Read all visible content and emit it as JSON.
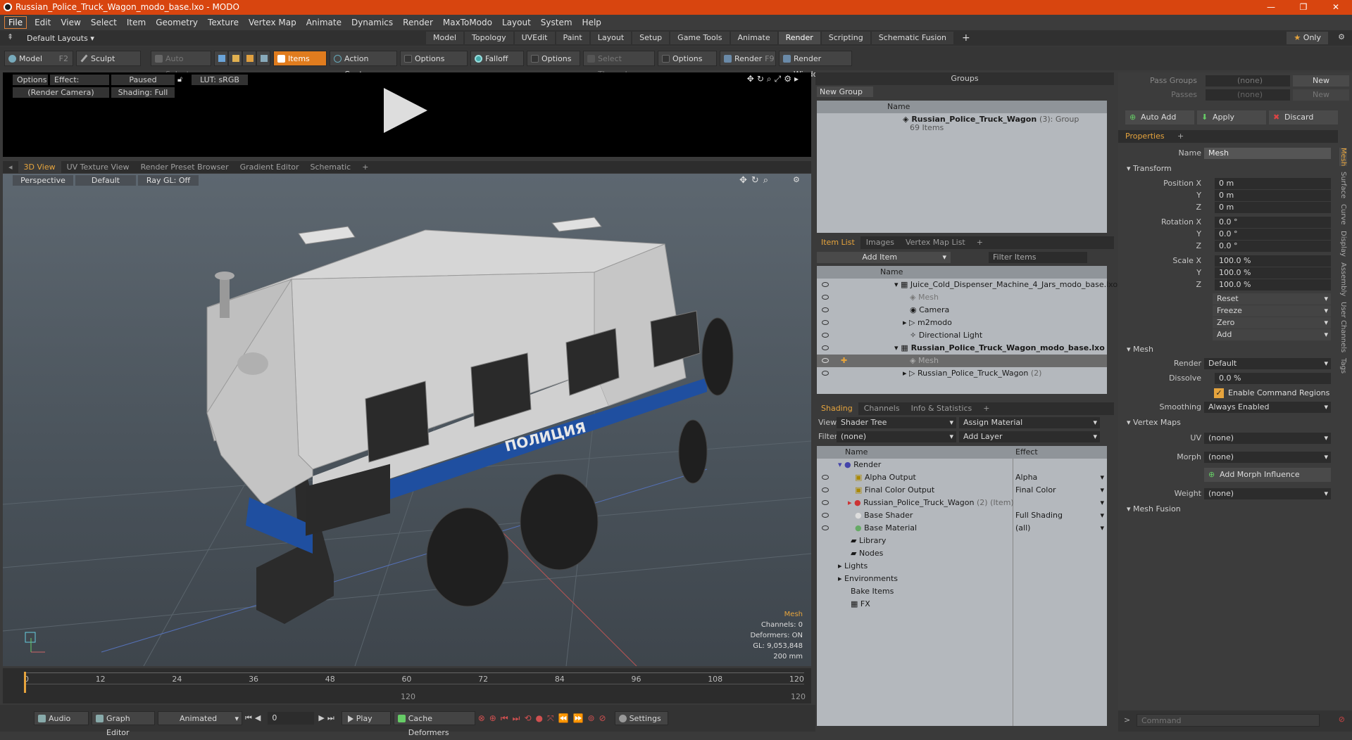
{
  "window": {
    "title": "Russian_Police_Truck_Wagon_modo_base.lxo - MODO"
  },
  "menu": [
    "File",
    "Edit",
    "View",
    "Select",
    "Item",
    "Geometry",
    "Texture",
    "Vertex Map",
    "Animate",
    "Dynamics",
    "Render",
    "MaxToModo",
    "Layout",
    "System",
    "Help"
  ],
  "layout": {
    "dropdown": "Default Layouts",
    "only": "Only",
    "tabs": [
      "Model",
      "Topology",
      "UVEdit",
      "Paint",
      "Layout",
      "Setup",
      "Game Tools",
      "Animate",
      "Render",
      "Scripting",
      "Schematic Fusion"
    ],
    "active_tab": "Render"
  },
  "toolbar": {
    "model": "Model",
    "model_key": "F2",
    "sculpt": "Sculpt",
    "auto_select": "Auto Select",
    "items": "Items",
    "action_center": "Action Center",
    "options1": "Options",
    "falloff": "Falloff",
    "options2": "Options",
    "select_through": "Select Through",
    "options3": "Options",
    "render": "Render",
    "render_key": "F9",
    "render_window": "Render Window"
  },
  "preview": {
    "options": "Options",
    "effect": "Effect: (Shadi...",
    "paused": "Paused",
    "lut": "LUT: sRGB",
    "camera": "(Render Camera)",
    "shading": "Shading: Full"
  },
  "viewport_tabs": [
    "3D View",
    "UV Texture View",
    "Render Preset Browser",
    "Gradient Editor",
    "Schematic"
  ],
  "viewport": {
    "perspective": "Perspective",
    "default": "Default",
    "raygl": "Ray GL: Off",
    "truck_text": "ПОЛИЦИЯ",
    "stats": {
      "mesh": "Mesh",
      "channels": "Channels: 0",
      "deformers": "Deformers: ON",
      "gl": "GL: 9,053,848",
      "scale": "200 mm"
    }
  },
  "timeline": {
    "ticks": [
      "0",
      "12",
      "24",
      "36",
      "48",
      "60",
      "72",
      "84",
      "96",
      "108",
      "120"
    ],
    "mid": "120",
    "end": "120"
  },
  "bottom": {
    "audio": "Audio",
    "graph_editor": "Graph Editor",
    "animated": "Animated",
    "frame": "0",
    "play": "Play",
    "cache": "Cache Deformers",
    "settings": "Settings"
  },
  "groups": {
    "title": "Groups",
    "new_group": "New Group",
    "col_name": "Name",
    "item_name": "Russian_Police_Truck_Wagon",
    "item_count": "(3)",
    "item_type": ": Group",
    "item_sub": "69 Items"
  },
  "itemlist": {
    "tabs": [
      "Item List",
      "Images",
      "Vertex Map List"
    ],
    "add_item": "Add Item",
    "filter": "Filter Items",
    "col_name": "Name",
    "rows": [
      {
        "label": "Juice_Cold_Dispenser_Machine_4_Jars_modo_base.lxo",
        "indent": 0
      },
      {
        "label": "Mesh",
        "indent": 1
      },
      {
        "label": "Camera",
        "indent": 1
      },
      {
        "label": "m2modo",
        "indent": 1
      },
      {
        "label": "Directional Light",
        "indent": 1
      },
      {
        "label": "Russian_Police_Truck_Wagon_modo_base.lxo",
        "indent": 0
      },
      {
        "label": "Mesh",
        "indent": 1
      },
      {
        "label": "Russian_Police_Truck_Wagon",
        "indent": 1,
        "suffix": "(2)"
      }
    ]
  },
  "shading": {
    "tabs": [
      "Shading",
      "Channels",
      "Info & Statistics"
    ],
    "view_label": "View",
    "view_value": "Shader Tree",
    "assign": "Assign Material",
    "filter_label": "Filter",
    "filter_value": "(none)",
    "add_layer": "Add Layer",
    "col_name": "Name",
    "col_effect": "Effect",
    "rows": [
      {
        "name": "Render",
        "effect": "",
        "indent": 0
      },
      {
        "name": "Alpha Output",
        "effect": "Alpha",
        "indent": 1
      },
      {
        "name": "Final Color Output",
        "effect": "Final Color",
        "indent": 1
      },
      {
        "name": "Russian_Police_Truck_Wagon",
        "effect": "",
        "indent": 1,
        "suffix": "(2) (Item)"
      },
      {
        "name": "Base Shader",
        "effect": "Full Shading",
        "indent": 1
      },
      {
        "name": "Base Material",
        "effect": "(all)",
        "indent": 1
      },
      {
        "name": "Library",
        "effect": "",
        "indent": 0
      },
      {
        "name": "Nodes",
        "effect": "",
        "indent": 0
      },
      {
        "name": "Lights",
        "effect": "",
        "indent": -1
      },
      {
        "name": "Environments",
        "effect": "",
        "indent": -1
      },
      {
        "name": "Bake Items",
        "effect": "",
        "indent": -1
      },
      {
        "name": "FX",
        "effect": "",
        "indent": -1
      }
    ]
  },
  "passes": {
    "pass_groups": "Pass Groups",
    "pass_val": "(none)",
    "new": "New",
    "passes": "Passes",
    "passes_val": "(none)",
    "new2": "New",
    "auto_add": "Auto Add",
    "apply": "Apply",
    "discard": "Discard"
  },
  "properties": {
    "tab": "Properties",
    "name_label": "Name",
    "name_value": "Mesh",
    "transform": "Transform",
    "pos_label": "Position X",
    "rot_label": "Rotation X",
    "scale_label": "Scale X",
    "y": "Y",
    "z": "Z",
    "pos": [
      "0 m",
      "0 m",
      "0 m"
    ],
    "rot": [
      "0.0 °",
      "0.0 °",
      "0.0 °"
    ],
    "scl": [
      "100.0 %",
      "100.0 %",
      "100.0 %"
    ],
    "reset": "Reset",
    "freeze": "Freeze",
    "zero": "Zero",
    "add": "Add",
    "mesh": "Mesh",
    "render_label": "Render",
    "render_value": "Default",
    "dissolve_label": "Dissolve",
    "dissolve_value": "0.0 %",
    "enable_cmd": "Enable Command Regions",
    "smoothing_label": "Smoothing",
    "smoothing_value": "Always Enabled",
    "vertex_maps": "Vertex Maps",
    "uv_label": "UV",
    "uv_value": "(none)",
    "morph_label": "Morph",
    "morph_value": "(none)",
    "add_morph": "Add Morph Influence",
    "weight_label": "Weight",
    "weight_value": "(none)",
    "mesh_fusion": "Mesh Fusion",
    "side_tabs": [
      "Mesh",
      "Surface",
      "Curve",
      "Display",
      "Assembly",
      "User Channels",
      "Tags"
    ]
  },
  "command": {
    "placeholder": "Command"
  }
}
